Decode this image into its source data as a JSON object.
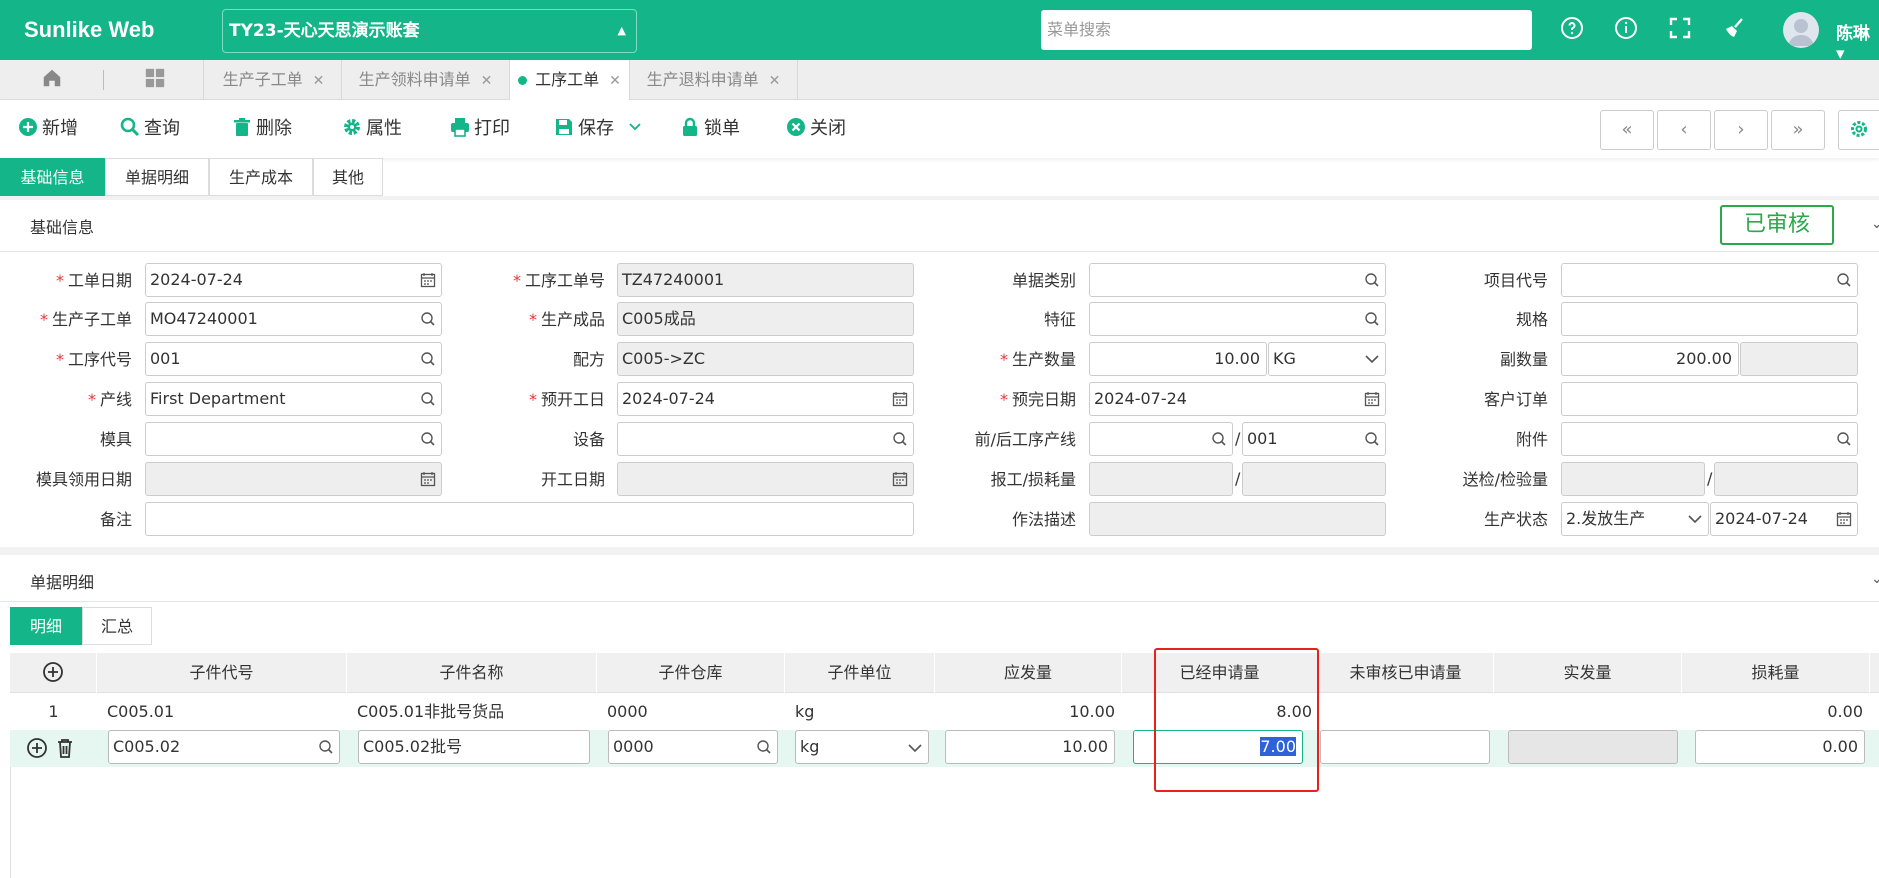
{
  "header": {
    "brand": "Sunlike Web",
    "account": "TY23-天心天思演示账套",
    "search_placeholder": "菜单搜索",
    "user_name": "陈琳",
    "icons": [
      "help-circle-icon",
      "info-circle-icon",
      "fullscreen-icon",
      "broom-clean-icon"
    ]
  },
  "tabs": [
    {
      "label": "生产子工单"
    },
    {
      "label": "生产领料申请单"
    },
    {
      "label": "工序工单",
      "active": true
    },
    {
      "label": "生产退料申请单"
    }
  ],
  "toolbar": {
    "new": "新增",
    "query": "查询",
    "delete": "删除",
    "props": "属性",
    "print": "打印",
    "save": "保存",
    "lock": "锁单",
    "close": "关闭"
  },
  "subtabs": [
    "基础信息",
    "单据明细",
    "生产成本",
    "其他"
  ],
  "basic": {
    "title": "基础信息",
    "status": "已审核",
    "labels": {
      "work_date": "工单日期",
      "op_order_no": "工序工单号",
      "doc_type": "单据类别",
      "project_code": "项目代号",
      "sub_order": "生产子工单",
      "product": "生产成品",
      "feature": "特征",
      "spec": "规格",
      "op_code": "工序代号",
      "formula": "配方",
      "prod_qty": "生产数量",
      "sub_qty": "副数量",
      "line": "产线",
      "plan_start": "预开工日",
      "plan_finish": "预完日期",
      "customer_order": "客户订单",
      "mold": "模具",
      "equipment": "设备",
      "prev_next_line": "前/后工序产线",
      "attachment": "附件",
      "mold_date": "模具领用日期",
      "start_date": "开工日期",
      "report_loss": "报工/损耗量",
      "inspect_qty": "送检/检验量",
      "remark": "备注",
      "method": "作法描述",
      "prod_status": "生产状态"
    },
    "values": {
      "work_date": "2024-07-24",
      "op_order_no": "TZ47240001",
      "sub_order": "MO47240001",
      "product": "C005成品",
      "op_code": "001",
      "formula": "C005->ZC",
      "prod_qty": "10.00",
      "prod_unit": "KG",
      "sub_qty": "200.00",
      "line": "First Department",
      "plan_start": "2024-07-24",
      "plan_finish": "2024-07-24",
      "next_line": "001",
      "prod_status": "2.发放生产",
      "status_date": "2024-07-24"
    }
  },
  "detail": {
    "title": "单据明细",
    "tabs": [
      "明细",
      "汇总"
    ],
    "columns": [
      "子件代号",
      "子件名称",
      "子件仓库",
      "子件单位",
      "应发量",
      "已经申请量",
      "未审核已申请量",
      "实发量",
      "损耗量"
    ],
    "rows": [
      {
        "no": "1",
        "code": "C005.01",
        "name": "C005.01非批号货品",
        "warehouse": "0000",
        "unit": "kg",
        "due": "10.00",
        "applied": "8.00",
        "unapproved": "",
        "actual": "",
        "loss": "0.00"
      },
      {
        "no": "",
        "code": "C005.02",
        "name": "C005.02批号",
        "warehouse": "0000",
        "unit": "kg",
        "due": "10.00",
        "applied": "7.00",
        "unapproved": "",
        "actual": "",
        "loss": "0.00"
      }
    ]
  },
  "colors": {
    "accent": "#13b589",
    "approved": "#2aa84a",
    "highlight": "#e8221b"
  }
}
